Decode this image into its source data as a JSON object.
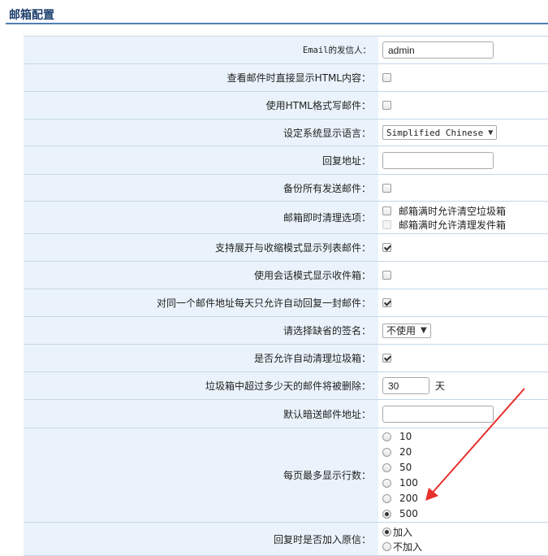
{
  "page": {
    "title": "邮箱配置"
  },
  "sender": {
    "label": "Email的发信人：",
    "value": "admin"
  },
  "show_html": {
    "label": "查看邮件时直接显示HTML内容：",
    "checked": false
  },
  "compose_html": {
    "label": "使用HTML格式写邮件：",
    "checked": false
  },
  "language": {
    "label": "设定系统显示语言：",
    "selected": "Simplified Chinese"
  },
  "reply_to": {
    "label": "回复地址：",
    "value": ""
  },
  "backup_sent": {
    "label": "备份所有发送邮件：",
    "checked": false
  },
  "cleanup": {
    "label": "邮箱即时清理选项：",
    "options": [
      {
        "label": "邮箱满时允许清空垃圾箱",
        "checked": false,
        "disabled": false
      },
      {
        "label": "邮箱满时允许清理发件箱",
        "checked": false,
        "disabled": true
      }
    ]
  },
  "collapse_list": {
    "label": "支持展开与收缩模式显示列表邮件：",
    "checked": true
  },
  "conversation_mode": {
    "label": "使用会话模式显示收件箱：",
    "checked": false
  },
  "auto_reply_once": {
    "label": "对同一个邮件地址每天只允许自动回复一封邮件：",
    "checked": true
  },
  "signature": {
    "label": "请选择缺省的签名：",
    "selected": "不使用"
  },
  "auto_clean_trash": {
    "label": "是否允许自动清理垃圾箱：",
    "checked": true
  },
  "trash_days": {
    "label": "垃圾箱中超过多少天的邮件将被删除：",
    "value": "30",
    "unit": "天"
  },
  "bcc": {
    "label": "默认暗送邮件地址：",
    "value": ""
  },
  "rows_per_page": {
    "label": "每页最多显示行数：",
    "options": [
      "10",
      "20",
      "50",
      "100",
      "200",
      "500"
    ],
    "selected": "500"
  },
  "quote_original": {
    "label": "回复时是否加入原信：",
    "options": [
      "加入",
      "不加入"
    ],
    "selected": "加入"
  },
  "colors": {
    "accent": "#1d3f6e",
    "row_bg": "#eaf3fb",
    "border": "#c6d7e6",
    "annotation_arrow": "#e8302c"
  }
}
